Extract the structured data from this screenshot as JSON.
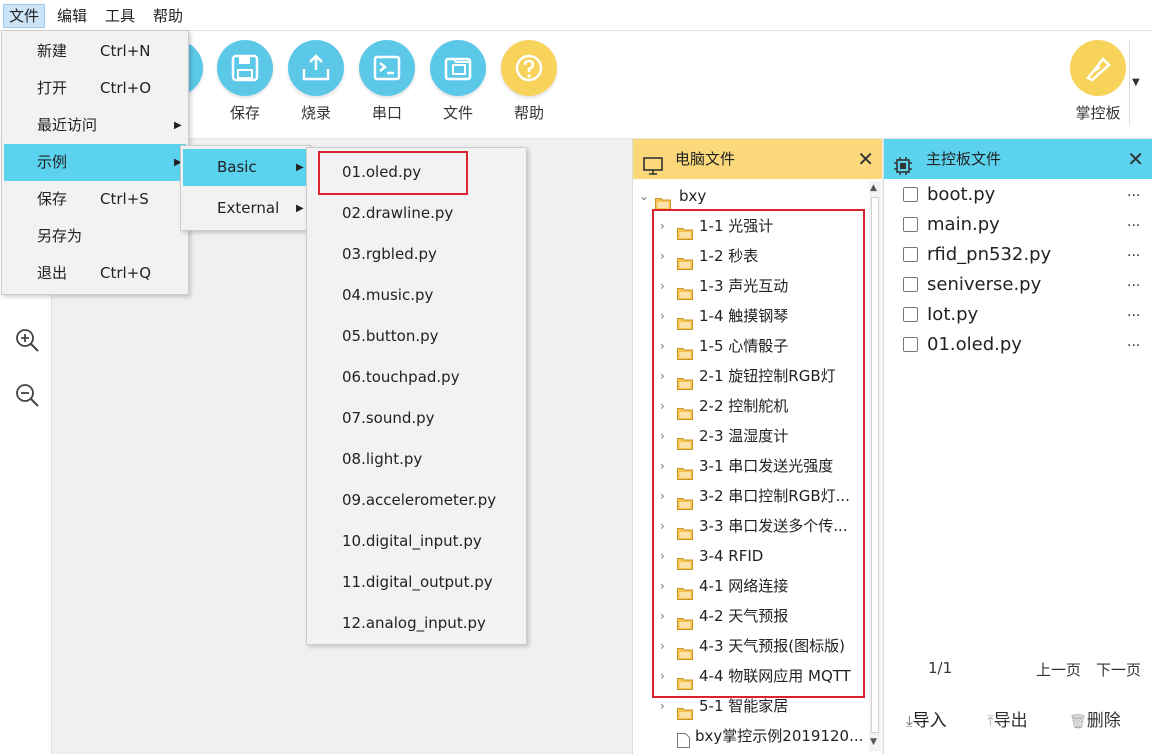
{
  "menubar": {
    "file": "文件",
    "edit": "编辑",
    "tools": "工具",
    "help": "帮助"
  },
  "toolbar": {
    "save": "保存",
    "burn": "烧录",
    "serial": "串口",
    "files": "文件",
    "help": "帮助",
    "board": "掌控板"
  },
  "file_menu": {
    "new": "新建",
    "new_shortcut": "Ctrl+N",
    "open": "打开",
    "open_shortcut": "Ctrl+O",
    "recent": "最近访问",
    "examples": "示例",
    "save": "保存",
    "save_shortcut": "Ctrl+S",
    "save_as": "另存为",
    "exit": "退出",
    "exit_shortcut": "Ctrl+Q"
  },
  "examples_menu": {
    "basic": "Basic",
    "external": "External"
  },
  "basic_menu": [
    "01.oled.py",
    "02.drawline.py",
    "03.rgbled.py",
    "04.music.py",
    "05.button.py",
    "06.touchpad.py",
    "07.sound.py",
    "08.light.py",
    "09.accelerometer.py",
    "10.digital_input.py",
    "11.digital_output.py",
    "12.analog_input.py"
  ],
  "pc_panel": {
    "title": "电脑文件",
    "close": "✕",
    "root": "bxy",
    "folders": [
      "1-1 光强计",
      "1-2 秒表",
      "1-3 声光互动",
      "1-4 触摸钢琴",
      "1-5 心情骰子",
      "2-1 旋钮控制RGB灯",
      "2-2 控制舵机",
      "2-3 温湿度计",
      "3-1 串口发送光强度",
      "3-2 串口控制RGB灯...",
      "3-3 串口发送多个传...",
      "3-4 RFID",
      "4-1 网络连接",
      "4-2 天气预报",
      "4-3 天气预报(图标版)",
      "4-4 物联网应用 MQTT",
      "5-1 智能家居"
    ],
    "file": "bxy掌控示例2019120..."
  },
  "board_panel": {
    "title": "主控板文件",
    "close": "✕",
    "files": [
      "boot.py",
      "main.py",
      "rfid_pn532.py",
      "seniverse.py",
      "Iot.py",
      "01.oled.py"
    ],
    "more": "...",
    "page": "1/1",
    "prev": "上一页",
    "next": "下一页",
    "import": "导入",
    "export": "导出",
    "delete": "删除"
  },
  "colors": {
    "accent_blue": "#5bd3ee",
    "accent_yellow": "#fbd97b",
    "highlight_red": "#d9232f",
    "icon_blue": "#5bc8e8"
  }
}
